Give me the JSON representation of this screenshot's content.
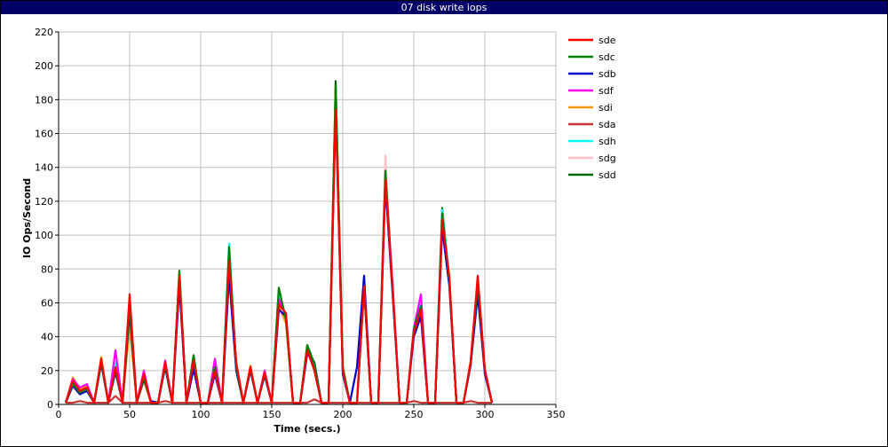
{
  "chart_data": {
    "type": "line",
    "title": "07 disk write iops",
    "xlabel": "Time (secs.)",
    "ylabel": "IO Ops/Second",
    "xlim": [
      0,
      350
    ],
    "ylim": [
      0,
      220
    ],
    "xticks": [
      0,
      50,
      100,
      150,
      200,
      250,
      300,
      350
    ],
    "yticks": [
      0,
      20,
      40,
      60,
      80,
      100,
      120,
      140,
      160,
      180,
      200,
      220
    ],
    "grid": true,
    "legend_position": "right",
    "x": [
      5,
      10,
      15,
      20,
      25,
      30,
      35,
      40,
      45,
      50,
      55,
      60,
      65,
      70,
      75,
      80,
      85,
      90,
      95,
      100,
      105,
      110,
      115,
      120,
      125,
      130,
      135,
      140,
      145,
      150,
      155,
      160,
      165,
      170,
      175,
      180,
      185,
      190,
      195,
      200,
      205,
      210,
      215,
      220,
      225,
      230,
      235,
      240,
      245,
      250,
      255,
      260,
      265,
      270,
      275,
      280,
      285,
      290,
      295,
      300,
      305
    ],
    "series": [
      {
        "name": "sde",
        "color": "#ff0000",
        "values": [
          1,
          14,
          8,
          10,
          1,
          27,
          1,
          22,
          1,
          65,
          1,
          18,
          1,
          1,
          25,
          1,
          76,
          1,
          26,
          1,
          1,
          20,
          1,
          85,
          25,
          1,
          22,
          1,
          19,
          1,
          59,
          54,
          1,
          1,
          32,
          20,
          1,
          1,
          174,
          20,
          1,
          1,
          70,
          1,
          1,
          132,
          70,
          1,
          1,
          42,
          56,
          1,
          1,
          109,
          75,
          1,
          1,
          25,
          76,
          20,
          1
        ]
      },
      {
        "name": "sdc",
        "color": "#008000",
        "values": [
          1,
          12,
          7,
          9,
          1,
          25,
          1,
          20,
          1,
          58,
          1,
          16,
          1,
          1,
          23,
          1,
          79,
          1,
          29,
          1,
          1,
          22,
          1,
          93,
          22,
          1,
          21,
          1,
          18,
          1,
          69,
          50,
          1,
          1,
          35,
          24,
          1,
          1,
          188,
          22,
          1,
          1,
          68,
          1,
          1,
          138,
          68,
          1,
          1,
          44,
          58,
          1,
          1,
          113,
          73,
          1,
          1,
          24,
          72,
          20,
          1
        ]
      },
      {
        "name": "sdb",
        "color": "#0000cc",
        "values": [
          1,
          11,
          6,
          8,
          1,
          24,
          1,
          19,
          1,
          55,
          1,
          15,
          2,
          1,
          22,
          1,
          70,
          1,
          21,
          1,
          1,
          18,
          1,
          76,
          20,
          1,
          20,
          1,
          17,
          1,
          56,
          52,
          1,
          1,
          30,
          25,
          1,
          1,
          178,
          18,
          1,
          22,
          76,
          1,
          1,
          130,
          66,
          1,
          1,
          40,
          52,
          1,
          1,
          104,
          70,
          1,
          1,
          23,
          65,
          18,
          1
        ]
      },
      {
        "name": "sdf",
        "color": "#ff00ff",
        "values": [
          1,
          15,
          10,
          12,
          1,
          26,
          1,
          32,
          1,
          60,
          1,
          20,
          1,
          1,
          26,
          1,
          74,
          1,
          25,
          1,
          1,
          27,
          1,
          86,
          24,
          1,
          22,
          1,
          20,
          1,
          62,
          53,
          1,
          1,
          33,
          21,
          1,
          1,
          180,
          21,
          1,
          1,
          71,
          1,
          1,
          135,
          72,
          1,
          1,
          45,
          65,
          1,
          1,
          111,
          74,
          1,
          1,
          25,
          74,
          21,
          1
        ]
      },
      {
        "name": "sdi",
        "color": "#ff9900",
        "values": [
          1,
          16,
          9,
          11,
          1,
          28,
          1,
          21,
          1,
          47,
          1,
          14,
          1,
          1,
          24,
          1,
          75,
          1,
          27,
          1,
          1,
          21,
          1,
          82,
          23,
          1,
          23,
          1,
          19,
          1,
          58,
          48,
          1,
          1,
          31,
          22,
          1,
          1,
          186,
          20,
          1,
          1,
          69,
          1,
          1,
          133,
          71,
          1,
          1,
          43,
          57,
          1,
          1,
          108,
          76,
          1,
          1,
          26,
          73,
          19,
          1
        ]
      },
      {
        "name": "sda",
        "color": "#cc3333",
        "values": [
          1,
          1,
          2,
          1,
          1,
          1,
          1,
          5,
          1,
          1,
          1,
          1,
          1,
          1,
          2,
          1,
          1,
          1,
          1,
          1,
          1,
          1,
          1,
          1,
          1,
          1,
          1,
          1,
          1,
          1,
          1,
          1,
          1,
          1,
          1,
          3,
          1,
          1,
          1,
          1,
          1,
          1,
          1,
          1,
          1,
          1,
          1,
          1,
          1,
          2,
          1,
          1,
          1,
          1,
          1,
          1,
          1,
          2,
          1,
          1,
          1
        ]
      },
      {
        "name": "sdh",
        "color": "#00ffff",
        "values": [
          1,
          13,
          8,
          10,
          1,
          26,
          1,
          25,
          1,
          57,
          1,
          17,
          1,
          1,
          24,
          1,
          77,
          1,
          28,
          1,
          1,
          23,
          1,
          95,
          23,
          1,
          22,
          1,
          19,
          1,
          66,
          51,
          1,
          1,
          34,
          23,
          1,
          1,
          185,
          21,
          1,
          1,
          72,
          1,
          1,
          137,
          69,
          1,
          1,
          43,
          60,
          1,
          1,
          115,
          75,
          1,
          1,
          24,
          73,
          20,
          1
        ]
      },
      {
        "name": "sdg",
        "color": "#ffc0cb",
        "values": [
          1,
          14,
          9,
          11,
          1,
          27,
          1,
          23,
          1,
          62,
          1,
          18,
          1,
          1,
          25,
          1,
          76,
          1,
          26,
          1,
          1,
          24,
          1,
          88,
          24,
          1,
          22,
          1,
          20,
          1,
          60,
          53,
          1,
          1,
          32,
          22,
          1,
          1,
          183,
          20,
          1,
          1,
          70,
          1,
          1,
          147,
          70,
          1,
          1,
          44,
          59,
          1,
          1,
          110,
          75,
          1,
          1,
          25,
          75,
          20,
          1
        ]
      },
      {
        "name": "sdd",
        "color": "#006600",
        "values": [
          1,
          12,
          6,
          8,
          1,
          25,
          1,
          21,
          1,
          60,
          1,
          17,
          1,
          1,
          24,
          1,
          78,
          1,
          29,
          1,
          1,
          22,
          1,
          91,
          22,
          1,
          21,
          1,
          19,
          1,
          68,
          50,
          1,
          1,
          35,
          24,
          1,
          1,
          191,
          22,
          1,
          1,
          69,
          1,
          1,
          140,
          69,
          1,
          1,
          44,
          57,
          1,
          1,
          116,
          74,
          1,
          1,
          24,
          72,
          20,
          1
        ]
      }
    ]
  }
}
